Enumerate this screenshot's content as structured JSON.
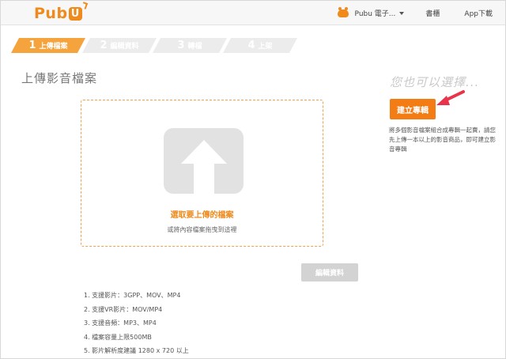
{
  "header": {
    "logo_text": "Pub",
    "logo_u": "U",
    "user_label": "Pubu 電子...",
    "bookshelf": "書櫃",
    "app_download": "App下載"
  },
  "steps": [
    {
      "num": "1",
      "label": "上傳檔案",
      "active": true
    },
    {
      "num": "2",
      "label": "編輯資料",
      "active": false
    },
    {
      "num": "3",
      "label": "轉檔",
      "active": false
    },
    {
      "num": "4",
      "label": "上架",
      "active": false
    }
  ],
  "page": {
    "title": "上傳影音檔案",
    "choose_file": "選取要上傳的檔案",
    "drag_hint": "或將內容檔案拖曳到這裡",
    "edit_button": "編輯資料"
  },
  "specs": [
    "1. 支援影片：3GPP、MOV、MP4",
    "2. 支援VR影片：MOV/MP4",
    "3. 支援音頻：MP3、MP4",
    "4. 檔案容量上限500MB",
    "5. 影片解析度建議 1280 x 720 以上"
  ],
  "side": {
    "also_title": "您也可以選擇...",
    "album_button": "建立專輯",
    "album_desc": "將多個影音檔案組合成專輯一起賣，請您先上傳一本以上的影音商品，即可建立影音專輯"
  },
  "colors": {
    "accent": "#f08a1c",
    "step_active": "#f5a33c",
    "step_inactive": "#ececec",
    "album_button": "#f37d14",
    "pointer_arrow": "#e8334a"
  },
  "icons": {
    "logo": "pubu-logo",
    "user_avatar": "crab-icon",
    "upload": "upload-arrow-icon",
    "pointer": "red-arrow-pointer-icon"
  }
}
